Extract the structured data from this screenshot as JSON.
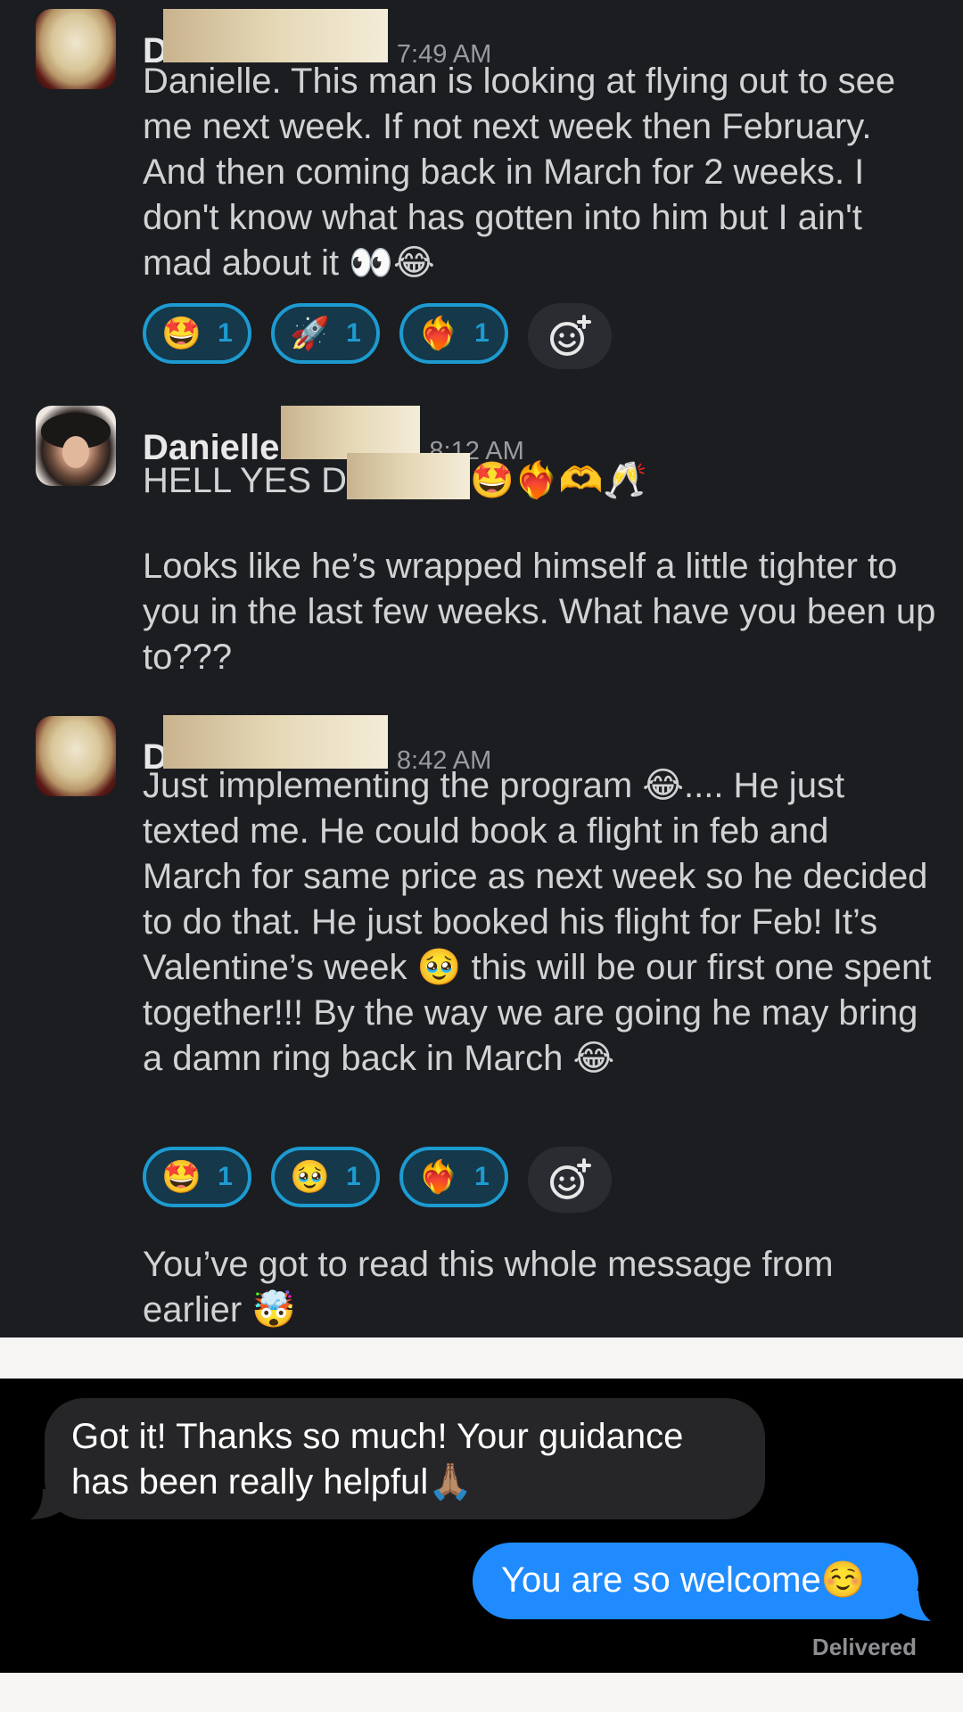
{
  "slack": {
    "messages": [
      {
        "author": "D",
        "time": "7:49 AM",
        "text": "Danielle. This man is looking at flying out to see me next week. If not next week then February. And then coming back in March for 2 weeks. I don't know what has gotten into him but I ain't mad about it 👀😂",
        "reactions": [
          {
            "emoji": "🤩",
            "count": "1"
          },
          {
            "emoji": "🚀",
            "count": "1"
          },
          {
            "emoji": "❤️‍🔥",
            "count": "1"
          }
        ]
      },
      {
        "author": "Danielle",
        "time": "8:12 AM",
        "line1_prefix": "HELL YES D",
        "line1_emojis": "🤩❤️‍🔥🫶🥂",
        "text": "Looks like he’s wrapped himself a little tighter to you in the last few weeks. What have you been up to???"
      },
      {
        "author": "D",
        "time": "8:42 AM",
        "text": "Just implementing the program 😂.... He just texted me. He could book a flight in feb and March for same price as next week so he decided to do that. He just booked his flight for Feb! It’s Valentine’s week 🥹 this will be our first one spent together!!! By the way we are going he may bring a damn ring back in March 😂",
        "reactions": [
          {
            "emoji": "🤩",
            "count": "1"
          },
          {
            "emoji": "🥹",
            "count": "1"
          },
          {
            "emoji": "❤️‍🔥",
            "count": "1"
          }
        ],
        "followup": "You’ve got to read this whole message from earlier 🤯"
      }
    ]
  },
  "imessage": {
    "incoming": "Got it! Thanks so much! Your guidance has been really helpful🙏🏽",
    "outgoing": "You are so welcome☺️",
    "status": "Delivered"
  },
  "icons": {
    "add_reaction": "add-reaction-icon"
  },
  "colors": {
    "slack_bg": "#1b1d21",
    "reaction_border": "#1d9bd1",
    "imessage_blue": "#1f8bff",
    "imessage_gray": "#262628"
  }
}
